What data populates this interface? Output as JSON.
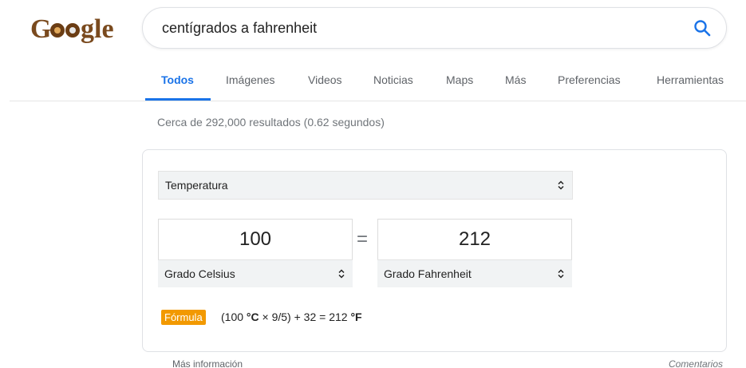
{
  "logo": {
    "text": "Google"
  },
  "search": {
    "query": "centígrados a fahrenheit"
  },
  "tabs": [
    {
      "label": "Todos",
      "active": true
    },
    {
      "label": "Imágenes"
    },
    {
      "label": "Videos"
    },
    {
      "label": "Noticias"
    },
    {
      "label": "Maps"
    },
    {
      "label": "Más"
    },
    {
      "label": "Preferencias"
    },
    {
      "label": "Herramientas"
    }
  ],
  "result_stats": "Cerca de 292,000 resultados (0.62 segundos)",
  "converter": {
    "unit_type": "Temperatura",
    "from": {
      "value": "100",
      "unit": "Grado Celsius"
    },
    "equals": "=",
    "to": {
      "value": "212",
      "unit": "Grado Fahrenheit"
    },
    "formula_label": "Fórmula",
    "formula": {
      "p1": "(100 ",
      "u1": "°C",
      "p2": " × 9/5) + 32 = 212 ",
      "u2": "°F"
    }
  },
  "footer": {
    "more_info": "Más información",
    "feedback": "Comentarios"
  },
  "colors": {
    "accent": "#1a73e8",
    "formula_badge": "#f29900",
    "muted": "#70757a"
  }
}
